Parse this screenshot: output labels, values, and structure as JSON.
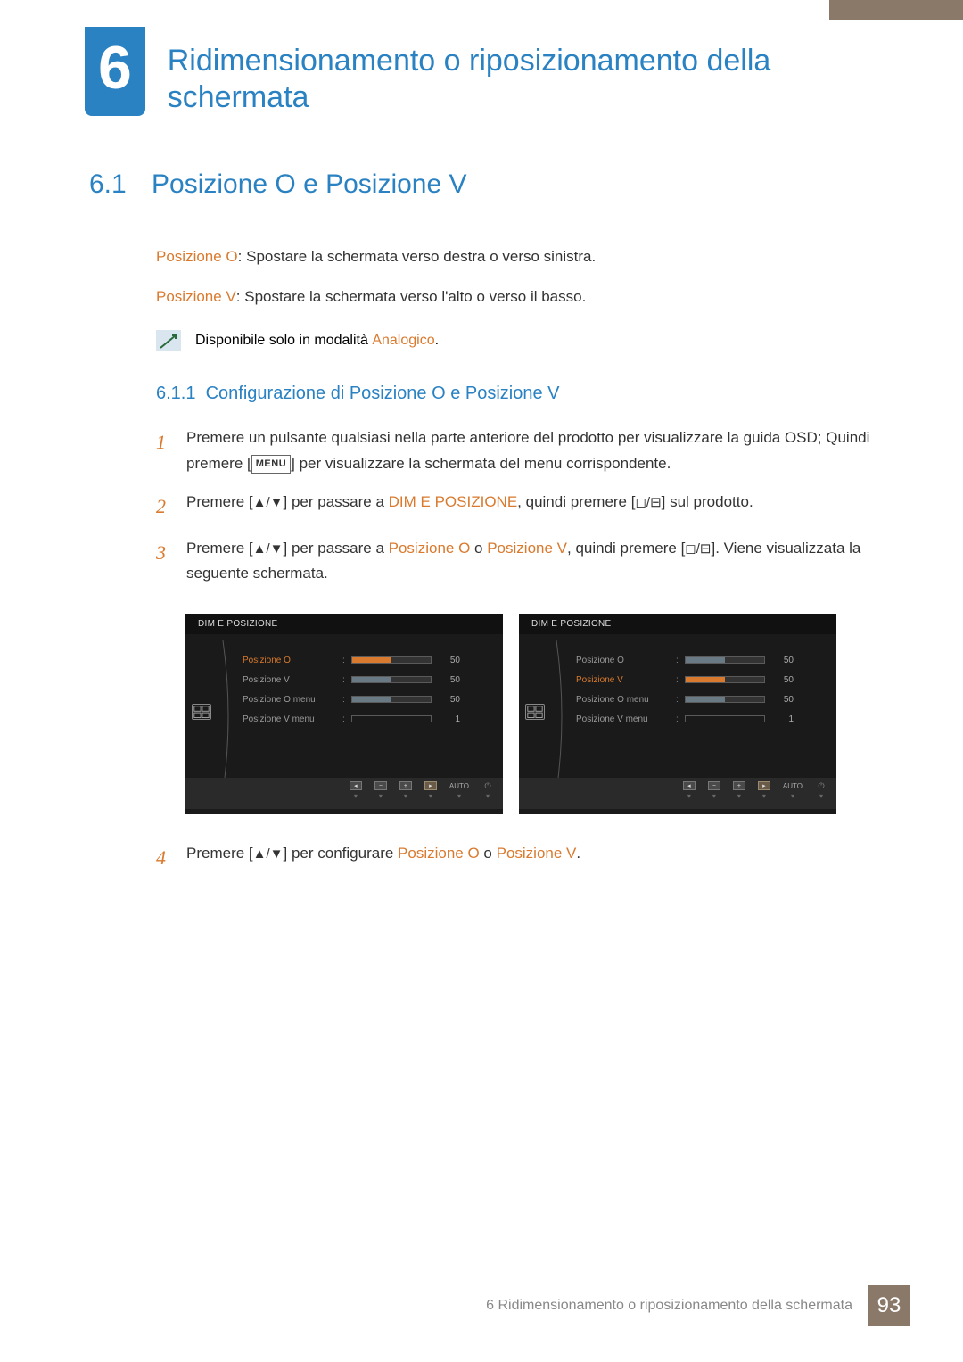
{
  "chapter": {
    "number": "6",
    "title": "Ridimensionamento o riposizionamento della schermata"
  },
  "section": {
    "number": "6.1",
    "title": "Posizione O e Posizione V"
  },
  "intro": {
    "posO_label": "Posizione O",
    "posO_text": ": Spostare la schermata verso destra o verso sinistra.",
    "posV_label": "Posizione V",
    "posV_text": ": Spostare la schermata verso l'alto o verso il basso.",
    "note_prefix": "Disponibile solo in modalità ",
    "note_mode": "Analogico",
    "note_suffix": "."
  },
  "subsection": {
    "number": "6.1.1",
    "title": "Configurazione di Posizione O e Posizione V"
  },
  "steps": {
    "s1a": "Premere un pulsante qualsiasi nella parte anteriore del prodotto per visualizzare la guida OSD; Quindi premere [",
    "s1_menu": "MENU",
    "s1b": "] per visualizzare la schermata del menu corrispondente.",
    "s2a": "Premere [",
    "s2b": "] per passare a ",
    "s2_target": "DIM E POSIZIONE",
    "s2c": ", quindi premere [",
    "s2d": "] sul prodotto.",
    "s3a": "Premere [",
    "s3b": "] per passare a ",
    "s3_o": "Posizione O",
    "s3_or": " o ",
    "s3_v": "Posizione V",
    "s3c": ", quindi premere [",
    "s3d": "]. Viene visualizzata la seguente schermata.",
    "s4a": "Premere [",
    "s4b": "] per configurare ",
    "s4_o": "Posizione O",
    "s4_or": " o ",
    "s4_v": "Posizione V",
    "s4c": "."
  },
  "osd": {
    "title": "DIM E POSIZIONE",
    "rows": [
      {
        "label": "Posizione O",
        "value": "50",
        "fill": 50,
        "hollow": false
      },
      {
        "label": "Posizione V",
        "value": "50",
        "fill": 50,
        "hollow": false
      },
      {
        "label": "Posizione O menu",
        "value": "50",
        "fill": 50,
        "hollow": false
      },
      {
        "label": "Posizione V menu",
        "value": "1",
        "fill": 0,
        "hollow": true
      }
    ],
    "left_selected_index": 0,
    "right_selected_index": 1,
    "footer": {
      "auto": "AUTO"
    }
  },
  "footer": {
    "text": "6 Ridimensionamento o riposizionamento della schermata",
    "page": "93"
  }
}
